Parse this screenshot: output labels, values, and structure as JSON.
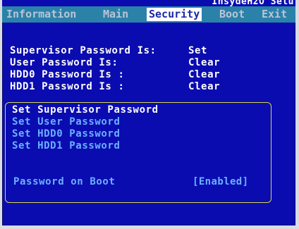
{
  "header": {
    "vendor_title": "InsydeH2O Setu"
  },
  "menu": {
    "tabs": [
      {
        "label": "Information"
      },
      {
        "label": "Main"
      },
      {
        "label": "Security"
      },
      {
        "label": "Boot"
      },
      {
        "label": "Exit"
      }
    ],
    "active_tab": "Security"
  },
  "status_rows": [
    {
      "label": "Supervisor Password Is:",
      "value": "Set"
    },
    {
      "label": "User Password Is:",
      "value": "Clear"
    },
    {
      "label": "HDD0 Password Is :",
      "value": "Clear"
    },
    {
      "label": "HDD1 Password Is :",
      "value": "Clear"
    }
  ],
  "password_menu": {
    "items": [
      {
        "label": "Set Supervisor Password"
      },
      {
        "label": "Set User Password"
      },
      {
        "label": "Set HDD0 Password"
      },
      {
        "label": "Set HDD1 Password"
      }
    ],
    "selected_item": "Set Supervisor Password",
    "boot_option": {
      "label": "Password on Boot",
      "value": "[Enabled]"
    }
  },
  "colors": {
    "background": "#0a0cb0",
    "menubar": "#2a82a8",
    "active_tab_bg": "#ffffff",
    "active_tab_text": "#1c2aa6",
    "inactive_tab_text": "#bcc4d8",
    "status_text": "#ffffff",
    "selectable_text": "#6cb0ff",
    "selected_text": "#ffffff",
    "box_border": "#d8d850"
  }
}
